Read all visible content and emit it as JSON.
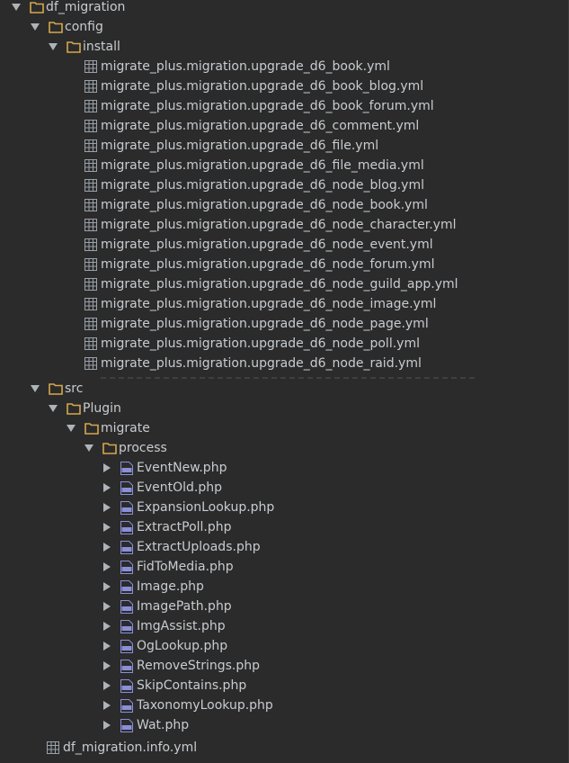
{
  "tree": {
    "root_folder": "df_migration",
    "config_folder": "config",
    "install_folder": "install",
    "install_files": [
      "migrate_plus.migration.upgrade_d6_book.yml",
      "migrate_plus.migration.upgrade_d6_book_blog.yml",
      "migrate_plus.migration.upgrade_d6_book_forum.yml",
      "migrate_plus.migration.upgrade_d6_comment.yml",
      "migrate_plus.migration.upgrade_d6_file.yml",
      "migrate_plus.migration.upgrade_d6_file_media.yml",
      "migrate_plus.migration.upgrade_d6_node_blog.yml",
      "migrate_plus.migration.upgrade_d6_node_book.yml",
      "migrate_plus.migration.upgrade_d6_node_character.yml",
      "migrate_plus.migration.upgrade_d6_node_event.yml",
      "migrate_plus.migration.upgrade_d6_node_forum.yml",
      "migrate_plus.migration.upgrade_d6_node_guild_app.yml",
      "migrate_plus.migration.upgrade_d6_node_image.yml",
      "migrate_plus.migration.upgrade_d6_node_page.yml",
      "migrate_plus.migration.upgrade_d6_node_poll.yml",
      "migrate_plus.migration.upgrade_d6_node_raid.yml"
    ],
    "src_folder": "src",
    "plugin_folder": "Plugin",
    "migrate_folder": "migrate",
    "process_folder": "process",
    "process_files": [
      "EventNew.php",
      "EventOld.php",
      "ExpansionLookup.php",
      "ExtractPoll.php",
      "ExtractUploads.php",
      "FidToMedia.php",
      "Image.php",
      "ImagePath.php",
      "ImgAssist.php",
      "OgLookup.php",
      "RemoveStrings.php",
      "SkipContains.php",
      "TaxonomyLookup.php",
      "Wat.php"
    ],
    "info_file": "df_migration.info.yml"
  },
  "colors": {
    "background": "#2b2b2b",
    "text": "#c8ccd0",
    "folder": "#d6a74e",
    "arrow": "#aeb3b8",
    "yml_icon": "#9aa2aa",
    "php_icon": "#8a8fd8"
  }
}
